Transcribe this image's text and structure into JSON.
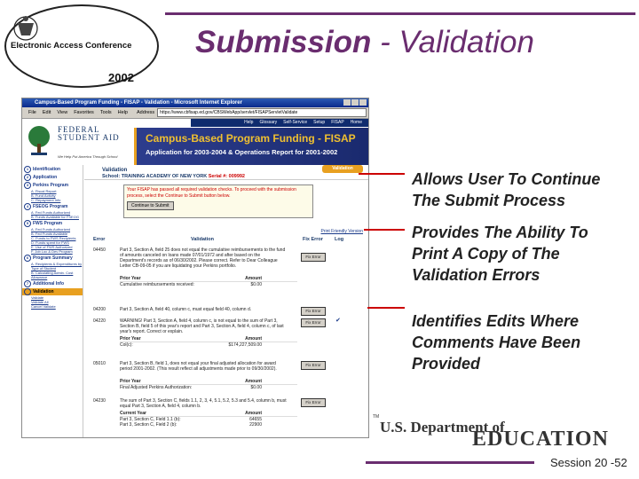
{
  "slide": {
    "logo_title": "Electronic Access Conference",
    "logo_year": "2002",
    "title_bold": "Submission",
    "title_rest": " - Validation",
    "callouts": [
      {
        "lines": [
          "Allows User To Continue",
          "The Submit Process"
        ]
      },
      {
        "lines": [
          "Provides The Ability To",
          "Print A Copy of The",
          "Validation Errors"
        ]
      },
      {
        "lines": [
          "Identifies Edits Where",
          "Comments Have Been",
          "Provided"
        ]
      }
    ],
    "dept_line1": "U.S. Department of",
    "dept_line2": "EDUCATION",
    "dept_tm": "TM",
    "footer": "Session 20 -52",
    "accent_color": "#6a2d6f",
    "connector_color": "#cc0000"
  },
  "browser": {
    "title": "Campus-Based Program Funding - FISAP - Validation - Microsoft Internet Explorer",
    "menu": [
      "File",
      "Edit",
      "View",
      "Favorites",
      "Tools",
      "Help"
    ],
    "address_label": "Address",
    "address": "https://www.cbfisap.ed.gov/CBSWebApp/servlet/FISAPServletValidate"
  },
  "fsa": {
    "name_line1": "FEDERAL",
    "name_line2": "STUDENT AID",
    "tagline": "We Help Put America Through School",
    "nav": [
      "Help",
      "Glossary",
      "Self-Service",
      "Setup",
      "FISAP",
      "Home"
    ],
    "banner_title": "Campus-Based Program Funding - FISAP",
    "banner_subtitle": "Application for 2003-2004 & Operations Report for 2001-2002"
  },
  "sidebar": {
    "items": [
      {
        "num": "1",
        "label": "Identification",
        "subs": []
      },
      {
        "num": "2",
        "label": "Application",
        "subs": []
      },
      {
        "num": "3",
        "label": "Perkins Program",
        "subs": [
          "A. Fiscal Report",
          "B. Fund Activity",
          "C. Repayment Info"
        ]
      },
      {
        "num": "4",
        "label": "FSEOG Program",
        "subs": [
          "A. Fed Funds Authorized",
          "B. Funds Available for FSEOG"
        ]
      },
      {
        "num": "5",
        "label": "FWS Program",
        "subs": [
          "A. Fed Funds Authorized",
          "B. Fed Funds Available",
          "C. Funds to FWS Recipients",
          "D. Funds spent for FWS",
          "E. Use of FWS Authorized",
          "F. Job Loc & Dev Program"
        ]
      },
      {
        "num": "6",
        "label": "Program Summary",
        "subs": [
          "A. Recipients & Expenditures by Type of Student",
          "B. Calculating Admin. Cost Allowance"
        ]
      },
      {
        "num": "7",
        "label": "Additional Info",
        "subs": []
      },
      {
        "num": "",
        "label": "Validation",
        "subs": [
          "Validate",
          "Validate All",
          "Cancel Validate"
        ]
      }
    ]
  },
  "main": {
    "section_title": "Validation",
    "school_label": "School:",
    "school_name": "TRAINING ACADEMY OF NEW YORK",
    "serial_label": "Serial #:",
    "serial": "009992",
    "tag": "Validation",
    "notice": "Your FISAP has passed all required validation checks. To proceed with the submission process, select the Continue to Submit button below.",
    "continue_button": "Continue to Submit",
    "print_link": "Print Friendly Version",
    "columns": [
      "Error",
      "Validation",
      "Fix Error",
      "Log"
    ],
    "fix_label": "Fix Error",
    "check_glyph": "✔",
    "rows": [
      {
        "code": "04450",
        "message": "Part 3, Section A, field 25 does not equal the cumulative reimbursements to the fund of amounts canceled on loans made 07/01/1972 and after based on the Department's records as of 06/30/2002. Please correct. Refer to Dear Colleague Letter CB-09-05 if you are liquidating your Perkins portfolio.",
        "sub_header": [
          "Prior Year",
          "Amount"
        ],
        "sub_rows": [
          [
            "Cumulative reimbursements received:",
            "$0.00"
          ]
        ],
        "log": ""
      },
      {
        "code": "04200",
        "message": "Part 3, Section A, field 40, column c, must equal field 40, column d.",
        "sub_header": [],
        "sub_rows": [],
        "log": ""
      },
      {
        "code": "04220",
        "message": "WARNING! Part 3, Section A, field 4, column c, is not equal to the sum of Part 3, Section B, field 5 of this year's report and Part 3, Section A, field 4, column c, of last year's report. Correct or explain.",
        "sub_header": [
          "Prior Year",
          "Amount"
        ],
        "sub_rows": [
          [
            "Col(c):",
            "$174,227,509.00"
          ]
        ],
        "log": "check"
      },
      {
        "code": "05010",
        "message": "Part 3, Section B, field 1, does not equal your final adjusted allocation for award period 2001-2002. (This result reflect all adjustments made prior to 09/30/2002).",
        "sub_header": [
          "Prior Year",
          "Amount"
        ],
        "sub_rows": [
          [
            "Final Adjusted Perkins Authorization:",
            "$0.00"
          ]
        ],
        "log": ""
      },
      {
        "code": "04230",
        "message": "The sum of Part 3, Section C, fields 1.1, 2, 3, 4, 5.1, 5.2, 5.3 and 5.4, column b, must equal Part 3, Section A, field 4, column b.",
        "sub_header": [
          "Current Year",
          "Amount"
        ],
        "sub_rows": [
          [
            "Part 3, Section C, Field 1.1 (b):",
            "64655"
          ],
          [
            "Part 3, Section C, Field 2 (b):",
            "22900"
          ]
        ],
        "log": ""
      }
    ]
  }
}
